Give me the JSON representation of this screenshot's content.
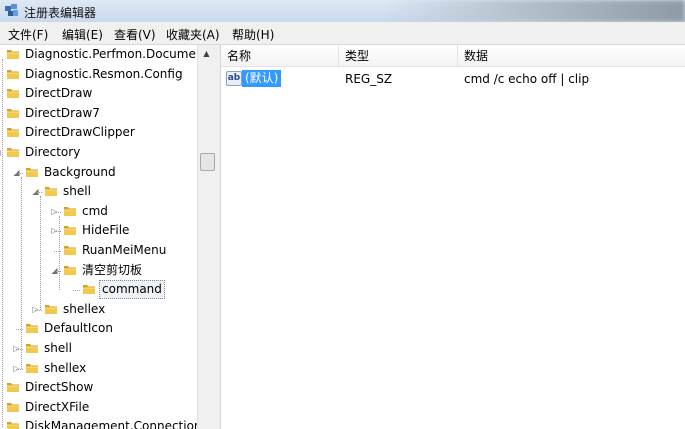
{
  "window": {
    "title": "注册表编辑器"
  },
  "menu": [
    {
      "label": "文件(F)"
    },
    {
      "label": "编辑(E)"
    },
    {
      "label": "查看(V)"
    },
    {
      "label": "收藏夹(A)"
    },
    {
      "label": "帮助(H)"
    }
  ],
  "tree": {
    "items": [
      {
        "label": "Diagnostic.Perfmon.Document",
        "depth": 0,
        "expander": ""
      },
      {
        "label": "Diagnostic.Resmon.Config",
        "depth": 0,
        "expander": ""
      },
      {
        "label": "DirectDraw",
        "depth": 0,
        "expander": ""
      },
      {
        "label": "DirectDraw7",
        "depth": 0,
        "expander": ""
      },
      {
        "label": "DirectDrawClipper",
        "depth": 0,
        "expander": ""
      },
      {
        "label": "Directory",
        "depth": 0,
        "expander": "expanded"
      },
      {
        "label": "Background",
        "depth": 1,
        "expander": "expanded"
      },
      {
        "label": "shell",
        "depth": 2,
        "expander": "expanded"
      },
      {
        "label": "cmd",
        "depth": 3,
        "expander": "collapsed"
      },
      {
        "label": "HideFile",
        "depth": 3,
        "expander": "collapsed"
      },
      {
        "label": "RuanMeiMenu",
        "depth": 3,
        "expander": ""
      },
      {
        "label": "清空剪切板",
        "depth": 3,
        "expander": "expanded"
      },
      {
        "label": "command",
        "depth": 4,
        "expander": "",
        "selected": true
      },
      {
        "label": "shellex",
        "depth": 2,
        "expander": "collapsed"
      },
      {
        "label": "DefaultIcon",
        "depth": 1,
        "expander": ""
      },
      {
        "label": "shell",
        "depth": 1,
        "expander": "collapsed"
      },
      {
        "label": "shellex",
        "depth": 1,
        "expander": "collapsed"
      },
      {
        "label": "DirectShow",
        "depth": 0,
        "expander": ""
      },
      {
        "label": "DirectXFile",
        "depth": 0,
        "expander": ""
      },
      {
        "label": "DiskManagement.Connection",
        "depth": 0,
        "expander": ""
      }
    ]
  },
  "values": {
    "columns": {
      "name": "名称",
      "type": "类型",
      "data": "数据"
    },
    "rows": [
      {
        "icon": "ab",
        "name": "(默认)",
        "type": "REG_SZ",
        "data": "cmd /c echo off | clip"
      }
    ]
  },
  "colors": {
    "selection": "#3399ff",
    "folder": "#e8b830",
    "titlebar": "#c9d9ee"
  }
}
